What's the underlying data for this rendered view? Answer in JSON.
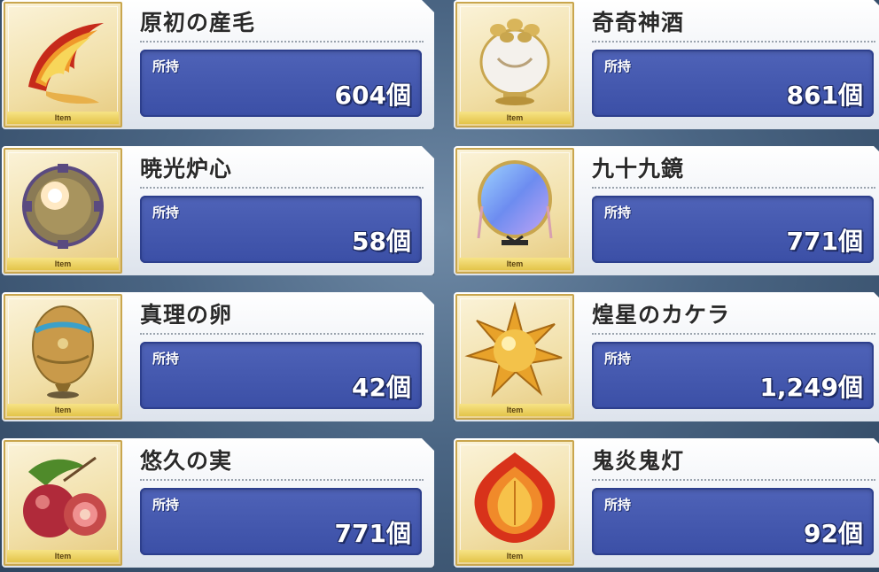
{
  "owned_label": "所持",
  "item_tag": "Item",
  "items": [
    {
      "name": "原初の産毛",
      "count": "604個",
      "icon": "flame-feather-icon"
    },
    {
      "name": "奇奇神酒",
      "count": "861個",
      "icon": "wine-jar-icon"
    },
    {
      "name": "暁光炉心",
      "count": "58個",
      "icon": "reactor-core-icon"
    },
    {
      "name": "九十九鏡",
      "count": "771個",
      "icon": "mirror-icon"
    },
    {
      "name": "真理の卵",
      "count": "42個",
      "icon": "golden-egg-icon"
    },
    {
      "name": "煌星のカケラ",
      "count": "1,249個",
      "icon": "star-fragment-icon"
    },
    {
      "name": "悠久の実",
      "count": "771個",
      "icon": "fig-fruit-icon"
    },
    {
      "name": "鬼炎鬼灯",
      "count": "92個",
      "icon": "flame-lantern-icon"
    }
  ]
}
